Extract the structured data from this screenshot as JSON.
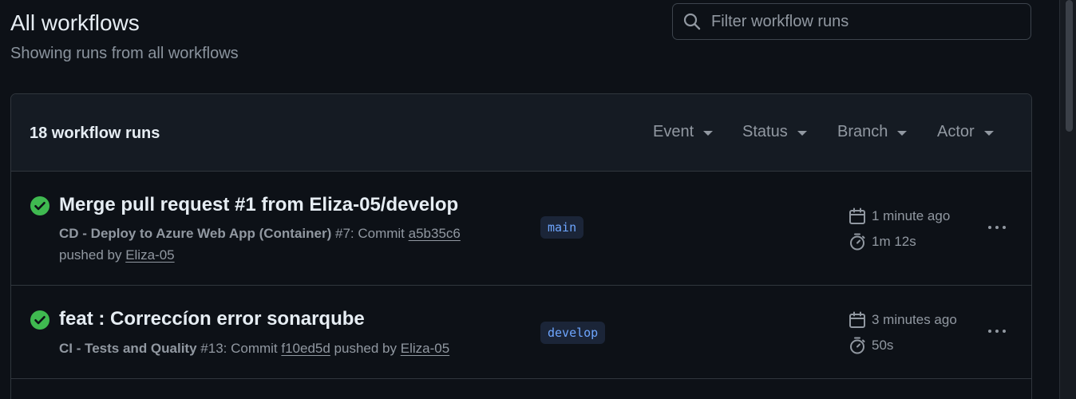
{
  "header": {
    "title": "All workflows",
    "subtitle": "Showing runs from all workflows",
    "filter_placeholder": "Filter workflow runs"
  },
  "runs_box": {
    "count_label": "18 workflow runs",
    "filters": {
      "event": "Event",
      "status": "Status",
      "branch": "Branch",
      "actor": "Actor"
    }
  },
  "runs": [
    {
      "status": "success",
      "title": "Merge pull request #1 from Eliza-05/develop",
      "workflow": "CD - Deploy to Azure Web App (Container)",
      "run_number": " #7: Commit ",
      "commit": "a5b35c6",
      "pushed_by_label": "pushed by ",
      "actor": "Eliza-05",
      "branch": "main",
      "time_ago": "1 minute ago",
      "duration": "1m 12s"
    },
    {
      "status": "success",
      "title": "feat : Correccíon error sonarqube",
      "workflow": "CI - Tests and Quality",
      "run_number": " #13: Commit ",
      "commit": "f10ed5d",
      "pushed_by_label": " pushed by ",
      "actor": "Eliza-05",
      "branch": "develop",
      "time_ago": "3 minutes ago",
      "duration": "50s"
    }
  ],
  "colors": {
    "background": "#0d1117",
    "success": "#3fb950",
    "branch_text": "#6ea6ff",
    "branch_bg": "#1b2538"
  },
  "icons": {
    "search": "search-icon",
    "success": "check-circle-fill-icon",
    "calendar": "calendar-icon",
    "stopwatch": "stopwatch-icon",
    "more": "kebab-horizontal-icon"
  }
}
